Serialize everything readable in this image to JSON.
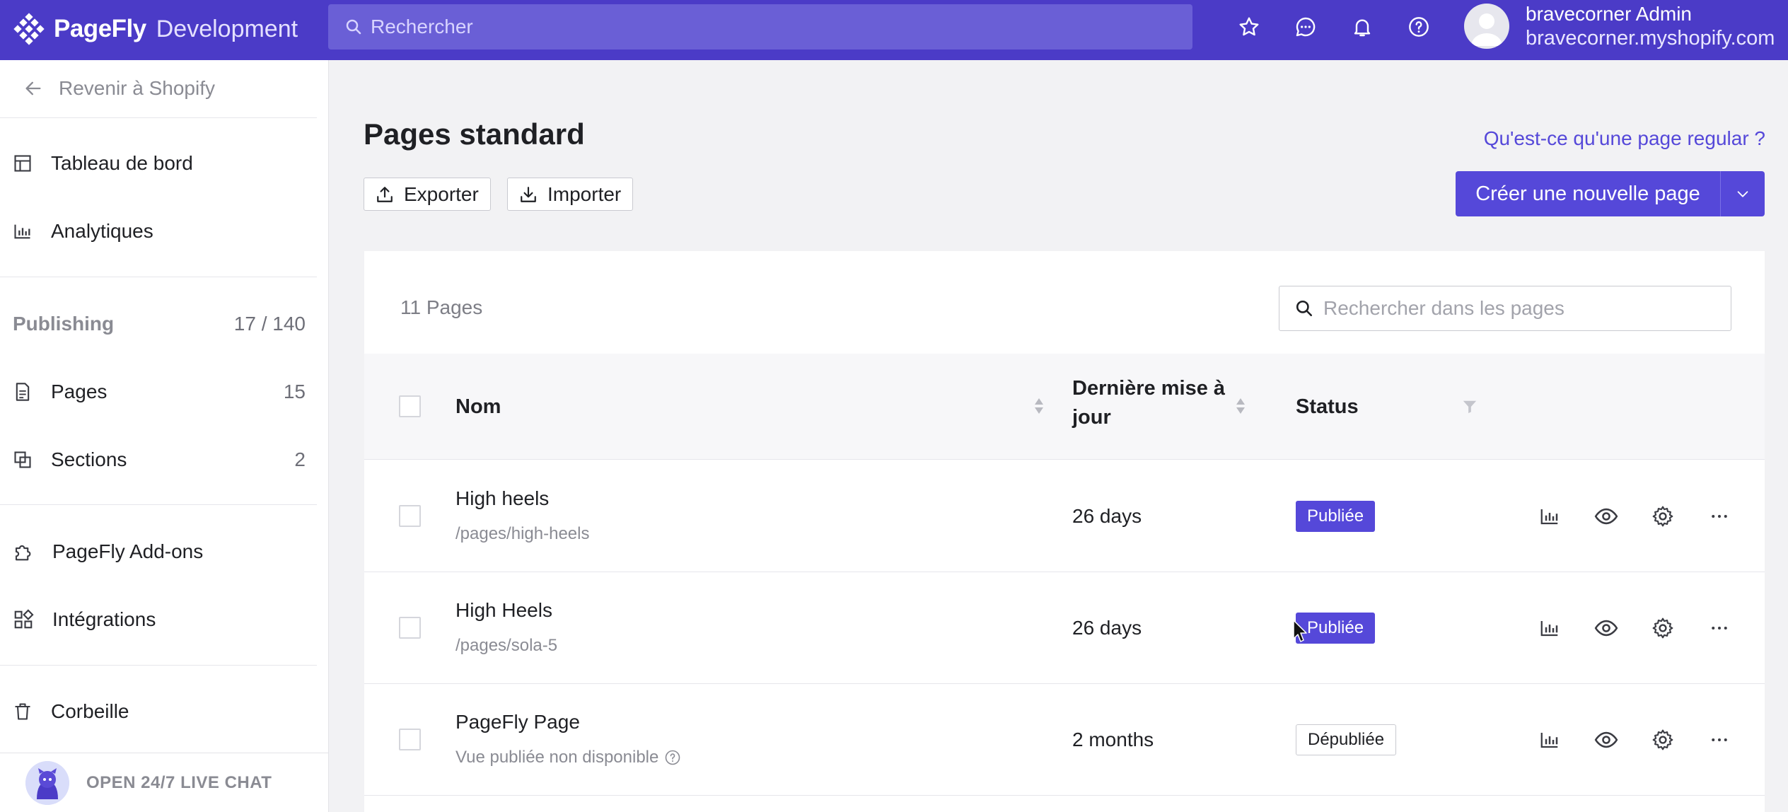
{
  "header": {
    "brand": "PageFly",
    "environment": "Development",
    "search_placeholder": "Rechercher",
    "user_name": "bravecorner Admin",
    "user_store": "bravecorner.myshopify.com",
    "icons": [
      "star-icon",
      "chat-icon",
      "bell-icon",
      "help-icon"
    ]
  },
  "sidebar": {
    "back_label": "Revenir à Shopify",
    "dashboard": "Tableau de bord",
    "analytics": "Analytiques",
    "publishing_label": "Publishing",
    "publishing_count": "17 / 140",
    "pages_label": "Pages",
    "pages_count": "15",
    "sections_label": "Sections",
    "sections_count": "2",
    "addons": "PageFly Add-ons",
    "integrations": "Intégrations",
    "trash": "Corbeille",
    "live_chat": "OPEN 24/7 LIVE CHAT"
  },
  "main": {
    "title": "Pages standard",
    "help_link": "Qu'est-ce qu'une page regular ?",
    "export_label": "Exporter",
    "import_label": "Importer",
    "create_label": "Créer une nouvelle page",
    "count_label": "11 Pages",
    "search_placeholder": "Rechercher dans les pages"
  },
  "table": {
    "col_name": "Nom",
    "col_updated_line1": "Dernière mise à",
    "col_updated_line2": "jour",
    "col_status": "Status",
    "rows": [
      {
        "name": "High heels",
        "path": "/pages/high-heels",
        "updated": "26 days",
        "status": "Publiée",
        "published": true
      },
      {
        "name": "High Heels",
        "path": "/pages/sola-5",
        "updated": "26 days",
        "status": "Publiée",
        "published": true
      },
      {
        "name": "PageFly Page",
        "path": "Vue publiée non disponible",
        "updated": "2 months",
        "status": "Dépubliée",
        "published": false
      }
    ]
  },
  "colors": {
    "brand": "#4b3bc7",
    "accent": "#5548d9"
  }
}
